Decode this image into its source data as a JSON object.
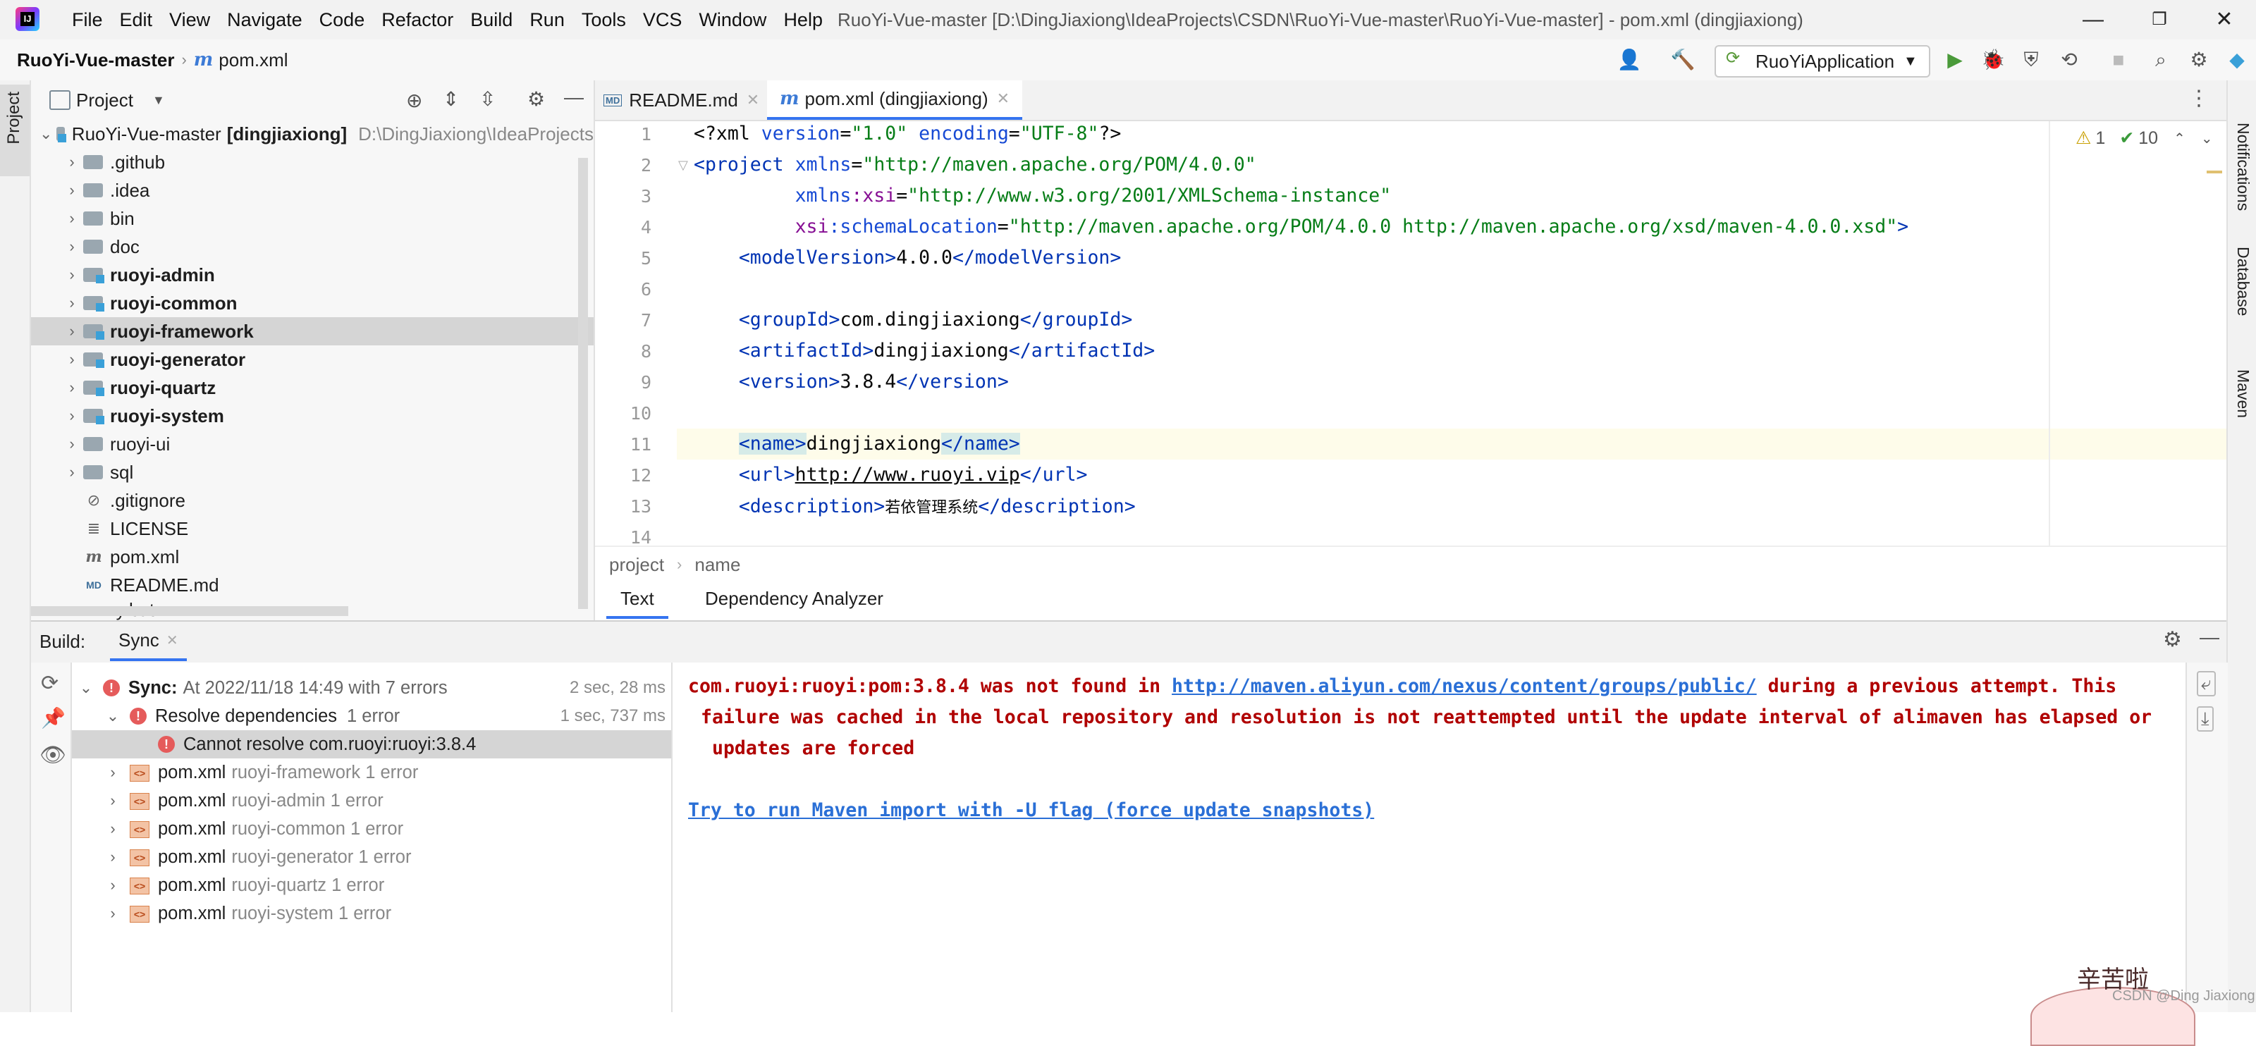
{
  "window": {
    "title": "RuoYi-Vue-master [D:\\DingJiaxiong\\IdeaProjects\\CSDN\\RuoYi-Vue-master\\RuoYi-Vue-master] - pom.xml (dingjiaxiong)",
    "menu": [
      "File",
      "Edit",
      "View",
      "Navigate",
      "Code",
      "Refactor",
      "Build",
      "Run",
      "Tools",
      "VCS",
      "Window",
      "Help"
    ]
  },
  "navbar": {
    "project": "RuoYi-Vue-master",
    "file": "pom.xml",
    "run_config": "RuoYiApplication"
  },
  "left_stripe": {
    "project_label": "Project"
  },
  "right_stripe": {
    "notifications": "Notifications",
    "database": "Database",
    "maven": "Maven"
  },
  "project_panel": {
    "title": "Project",
    "root_name": "RuoYi-Vue-master",
    "root_module": "[dingjiaxiong]",
    "root_path": "D:\\DingJiaxiong\\IdeaProjects",
    "items": [
      {
        "label": ".github"
      },
      {
        "label": ".idea"
      },
      {
        "label": "bin"
      },
      {
        "label": "doc"
      },
      {
        "label": "ruoyi-admin"
      },
      {
        "label": "ruoyi-common"
      },
      {
        "label": "ruoyi-framework"
      },
      {
        "label": "ruoyi-generator"
      },
      {
        "label": "ruoyi-quartz"
      },
      {
        "label": "ruoyi-system"
      },
      {
        "label": "ruoyi-ui"
      },
      {
        "label": "sql"
      },
      {
        "label": ".gitignore"
      },
      {
        "label": "LICENSE"
      },
      {
        "label": "pom.xml"
      },
      {
        "label": "README.md"
      },
      {
        "label": "ry.bat"
      }
    ]
  },
  "editor": {
    "tabs": [
      {
        "label": "README.md"
      },
      {
        "label": "pom.xml (dingjiaxiong)"
      }
    ],
    "inspections": {
      "warnings": "1",
      "checks": "10"
    },
    "line_numbers": [
      "1",
      "2",
      "3",
      "4",
      "5",
      "6",
      "7",
      "8",
      "9",
      "10",
      "11",
      "12",
      "13",
      "14"
    ],
    "lines": {
      "l1_decl": "<?xml",
      "l1_attr1": "version",
      "l1_val1": "\"1.0\"",
      "l1_attr2": "encoding",
      "l1_val2": "\"UTF-8\"",
      "l1_end": "?>",
      "l2_open": "<project",
      "l2_attr": "xmlns",
      "l2_val": "\"http://maven.apache.org/POM/4.0.0\"",
      "l3_ns": "xmlns",
      "l3_attr": ":xsi",
      "l3_val": "\"http://www.w3.org/2001/XMLSchema-instance\"",
      "l4_ns": "xsi",
      "l4_attr": ":schemaLocation",
      "l4_val": "\"http://maven.apache.org/POM/4.0.0 http://maven.apache.org/xsd/maven-4.0.0.xsd\"",
      "l4_end": ">",
      "l5_tag": "modelVersion",
      "l5_val": "4.0.0",
      "l7_tag": "groupId",
      "l7_val": "com.dingjiaxiong",
      "l8_tag": "artifactId",
      "l8_val": "dingjiaxiong",
      "l9_tag": "version",
      "l9_val": "3.8.4",
      "l11_tag": "name",
      "l11_val": "dingjiaxiong",
      "l12_tag": "url",
      "l12_val": "http://www.ruoyi.vip",
      "l13_tag": "description",
      "l13_val": "若依管理系统"
    },
    "breadcrumb": [
      "project",
      "name"
    ],
    "bottom_tabs": [
      "Text",
      "Dependency Analyzer"
    ]
  },
  "build": {
    "label": "Build:",
    "tab": "Sync",
    "tree": {
      "sync_label": "Sync:",
      "sync_detail": "At 2022/11/18 14:49 with 7 errors",
      "sync_time": "2 sec, 28 ms",
      "resolve_label": "Resolve dependencies",
      "resolve_count": "1 error",
      "resolve_time": "1 sec, 737 ms",
      "cannot_resolve": "Cannot resolve com.ruoyi:ruoyi:3.8.4",
      "pom_items": [
        {
          "file": "pom.xml",
          "module": "ruoyi-framework 1 error"
        },
        {
          "file": "pom.xml",
          "module": "ruoyi-admin 1 error"
        },
        {
          "file": "pom.xml",
          "module": "ruoyi-common 1 error"
        },
        {
          "file": "pom.xml",
          "module": "ruoyi-generator 1 error"
        },
        {
          "file": "pom.xml",
          "module": "ruoyi-quartz 1 error"
        },
        {
          "file": "pom.xml",
          "module": "ruoyi-system 1 error"
        }
      ]
    },
    "console": {
      "line1_a": "com.ruoyi:ruoyi:pom:3.8.4 was not found in ",
      "line1_link": "http://maven.aliyun.com/nexus/content/groups/public/",
      "line1_b": " during a previous attempt. This",
      "line2": "failure was cached in the local repository and resolution is not reattempted until the update interval of alimaven has elapsed or",
      "line3": "updates are forced",
      "action": "Try to run Maven import with -U flag (force update snapshots)"
    }
  },
  "watermark": {
    "text": "辛苦啦",
    "credit": "CSDN @Ding Jiaxiong"
  },
  "colors": {
    "accent": "#3574f0",
    "error": "#e55b5b",
    "console_error": "#b00000",
    "link": "#2a6fd6"
  }
}
